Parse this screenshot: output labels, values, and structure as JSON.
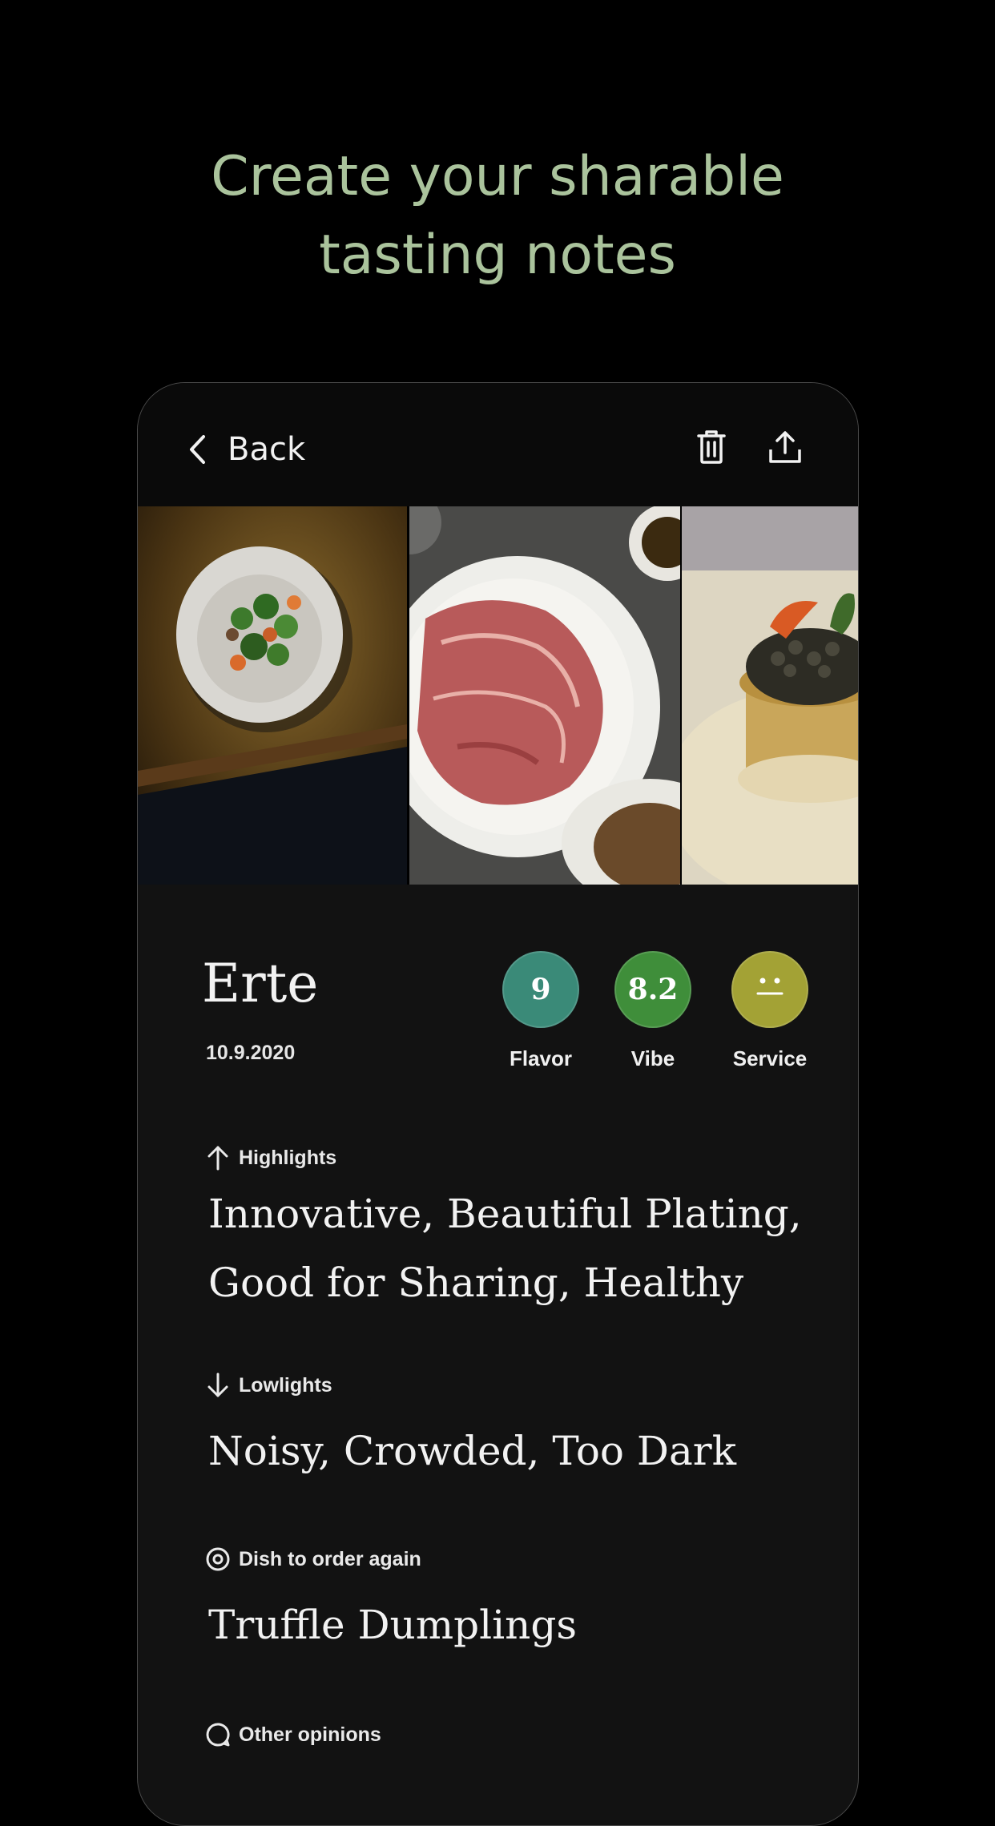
{
  "headline": {
    "line1": "Create your sharable",
    "line2": "tasting notes"
  },
  "colors": {
    "headline": "#aac39c",
    "flavor": "#3a8a78",
    "vibe": "#3f8e3a",
    "service": "#a3a235"
  },
  "topbar": {
    "back_label": "Back",
    "icons": [
      "chevron-left-icon",
      "trash-icon",
      "share-icon"
    ]
  },
  "photos": [
    "salad-bowl-photo",
    "prosciutto-plate-photo",
    "caviar-dish-photo"
  ],
  "restaurant": {
    "name": "Erte",
    "date": "10.9.2020"
  },
  "scores": [
    {
      "label": "Flavor",
      "value": "9"
    },
    {
      "label": "Vibe",
      "value": "8.2"
    },
    {
      "label": "Service",
      "value": "",
      "icon": "neutral-face-icon"
    }
  ],
  "sections": {
    "highlights": {
      "label": "Highlights",
      "line1": "Innovative, Beautiful Plating,",
      "line2": "Good for Sharing, Healthy"
    },
    "lowlights": {
      "label": "Lowlights",
      "text": "Noisy, Crowded, Too Dark"
    },
    "dish": {
      "label": "Dish to order again",
      "text": "Truffle Dumplings"
    },
    "opinions": {
      "label": "Other opinions"
    }
  }
}
